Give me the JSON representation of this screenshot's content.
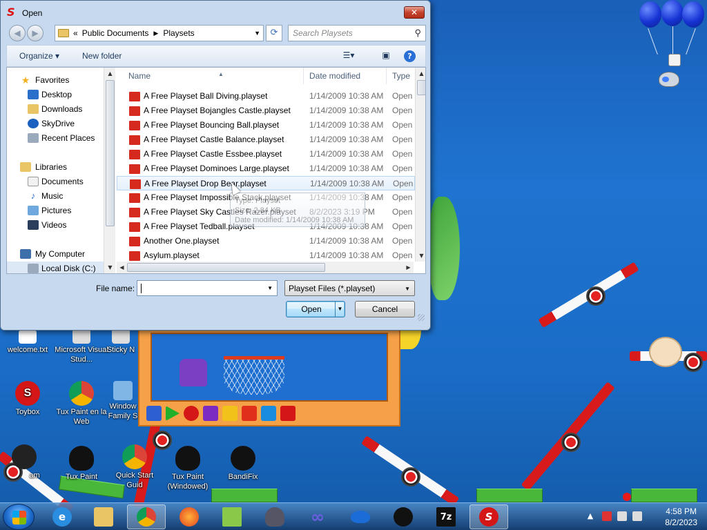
{
  "dialog": {
    "title": "Open",
    "close_label": "✕",
    "breadcrumb": {
      "prefix": "«",
      "items": [
        "Public Documents",
        "Playsets"
      ]
    },
    "search_placeholder": "Search Playsets",
    "toolbar": {
      "organize": "Organize ▾",
      "new_folder": "New folder"
    },
    "columns": {
      "name": "Name",
      "date": "Date modified",
      "type": "Type"
    },
    "nav": {
      "favorites": "Favorites",
      "desktop": "Desktop",
      "downloads": "Downloads",
      "skydrive": "SkyDrive",
      "recent": "Recent Places",
      "libraries": "Libraries",
      "documents": "Documents",
      "music": "Music",
      "pictures": "Pictures",
      "videos": "Videos",
      "computer": "My Computer",
      "localdisk": "Local Disk (C:)"
    },
    "files": [
      {
        "name": "A Free Playset Ball Diving.playset",
        "date": "1/14/2009 10:38 AM",
        "type": "Open I"
      },
      {
        "name": "A Free Playset Bojangles Castle.playset",
        "date": "1/14/2009 10:38 AM",
        "type": "Open I"
      },
      {
        "name": "A Free Playset Bouncing Ball.playset",
        "date": "1/14/2009 10:38 AM",
        "type": "Open I"
      },
      {
        "name": "A Free Playset Castle Balance.playset",
        "date": "1/14/2009 10:38 AM",
        "type": "Open I"
      },
      {
        "name": "A Free Playset Castle Essbee.playset",
        "date": "1/14/2009 10:38 AM",
        "type": "Open I"
      },
      {
        "name": "A Free Playset Dominoes Large.playset",
        "date": "1/14/2009 10:38 AM",
        "type": "Open I"
      },
      {
        "name": "A Free Playset Drop Bear.playset",
        "date": "1/14/2009 10:38 AM",
        "type": "Open I"
      },
      {
        "name": "A Free Playset Impossible Stack.playset",
        "date": "1/14/2009 10:38 AM",
        "type": "Open I"
      },
      {
        "name": "A Free Playset Sky Castles Razer.playset",
        "date": "8/2/2023 3:19 PM",
        "type": "Open I"
      },
      {
        "name": "A Free Playset Tedball.playset",
        "date": "1/14/2009 10:38 AM",
        "type": "Open I"
      },
      {
        "name": "Another One.playset",
        "date": "1/14/2009 10:38 AM",
        "type": "Open I"
      },
      {
        "name": "Asylum.playset",
        "date": "1/14/2009 10:38 AM",
        "type": "Open I"
      }
    ],
    "tooltip": {
      "line1": "Type: Playset",
      "line2": "Size: 2.84 KB",
      "line3": "Date modified: 1/14/2009 10:38 AM"
    },
    "file_name_label": "File name:",
    "file_name_value": "",
    "file_type": "Playset Files (*.playset)",
    "open_label": "Open",
    "cancel_label": "Cancel"
  },
  "desktop_icons": {
    "welcome": "welcome.txt",
    "msvs": "Microsoft Visual Stud...",
    "sticky": "Sticky N",
    "toybox": "Toybox",
    "tuxpaint_web": "Tux Paint en la Web",
    "windows_family": "Window Family S",
    "steam": "am",
    "tuxpaint": "Tux Paint",
    "quickstart": "Quick Start Guid",
    "tuxpaint_windowed": "Tux Paint (Windowed)",
    "bandifix": "BandiFix"
  },
  "taskbar": {
    "time": "4:58 PM",
    "date": "8/2/2023"
  },
  "colors": {
    "desktop_blue": "#1e74d0",
    "playset_red": "#d62a1e",
    "selection": "#dce8f6"
  }
}
